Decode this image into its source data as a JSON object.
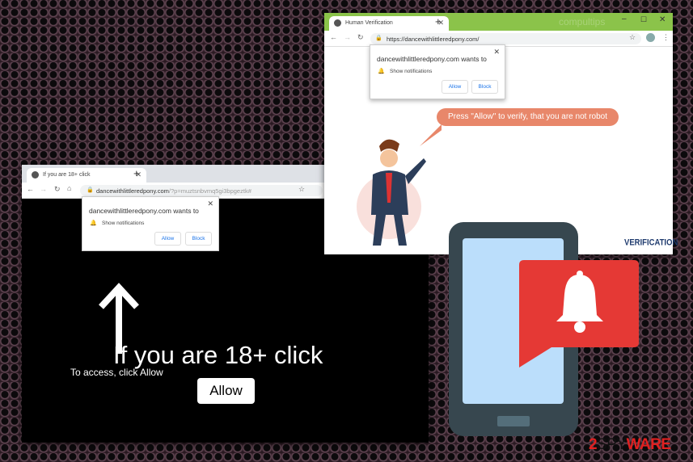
{
  "window_left": {
    "tab_title": "If you are 18+ click",
    "url_host": "dancewithlittleredpony.com",
    "url_rest": "/?p=muztsnbvmq5gi3bpgeztk#",
    "popup": {
      "title": "dancewithlittleredpony.com wants to",
      "permission": "Show notifications",
      "allow": "Allow",
      "block": "Block"
    },
    "heading": "If you are 18+ click",
    "subtext": "To access, click Allow",
    "allow_button": "Allow"
  },
  "window_right": {
    "tab_title": "Human Verification",
    "url": "https://dancewithlittleredpony.com/",
    "watermark": "compultips",
    "popup": {
      "title": "dancewithlittleredpony.com wants to",
      "permission": "Show notifications",
      "allow": "Allow",
      "block": "Block"
    },
    "speech": "Press \"Allow\" to verify, that you are not robot",
    "brand": "VERIFICATION"
  },
  "logo": {
    "prefix": "2",
    "mid": "SPY",
    "end": "WARE"
  },
  "colors": {
    "green_tab": "#8bc34a",
    "bubble": "#e8876a",
    "alert_red": "#e53935",
    "phone": "#37474f",
    "screen": "#bbdefb"
  }
}
